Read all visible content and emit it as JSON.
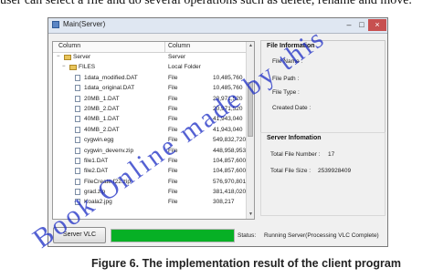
{
  "document": {
    "top_text": "user can select a file and do several operations such as delete, rename and move.",
    "caption": "Figure 6. The implementation result of the client program",
    "watermark": "Book Online made by this"
  },
  "window": {
    "title": "Main(Server)",
    "buttons": {
      "minimize": "–",
      "maximize": "□",
      "close": "×"
    }
  },
  "tree": {
    "columns": [
      "Column",
      "Column"
    ],
    "rows": [
      {
        "indent": 1,
        "kind": "root-folder",
        "expander": "−",
        "name": "Server",
        "type": "Server",
        "size": ""
      },
      {
        "indent": 2,
        "kind": "folder",
        "expander": "−",
        "name": "FILES",
        "type": "Local Folder",
        "size": ""
      },
      {
        "indent": 3,
        "kind": "file",
        "name": "1data_modified.DAT",
        "type": "File",
        "size": "10,485,760"
      },
      {
        "indent": 3,
        "kind": "file",
        "name": "1data_original.DAT",
        "type": "File",
        "size": "10,485,760"
      },
      {
        "indent": 3,
        "kind": "file",
        "name": "20MB_1.DAT",
        "type": "File",
        "size": "20,971,520"
      },
      {
        "indent": 3,
        "kind": "file",
        "name": "20MB_2.DAT",
        "type": "File",
        "size": "20,971,520"
      },
      {
        "indent": 3,
        "kind": "file",
        "name": "40MB_1.DAT",
        "type": "File",
        "size": "41,943,040"
      },
      {
        "indent": 3,
        "kind": "file",
        "name": "40MB_2.DAT",
        "type": "File",
        "size": "41,943,040"
      },
      {
        "indent": 3,
        "kind": "file",
        "name": "cygwin.egg",
        "type": "File",
        "size": "549,832,720"
      },
      {
        "indent": 3,
        "kind": "file",
        "name": "cygwin_devenv.zip",
        "type": "File",
        "size": "448,958,953"
      },
      {
        "indent": 3,
        "kind": "file",
        "name": "file1.DAT",
        "type": "File",
        "size": "104,857,600"
      },
      {
        "indent": 3,
        "kind": "file",
        "name": "file2.DAT",
        "type": "File",
        "size": "104,857,600"
      },
      {
        "indent": 3,
        "kind": "file",
        "name": "FileCreate f22.zip",
        "type": "File",
        "size": "576,970,801"
      },
      {
        "indent": 3,
        "kind": "file",
        "name": "grad.zip",
        "type": "File",
        "size": "381,418,020"
      },
      {
        "indent": 3,
        "kind": "file",
        "name": "Koala2.jpg",
        "type": "File",
        "size": "308,217"
      }
    ]
  },
  "file_info": {
    "legend": "File Information",
    "labels": [
      "File Name :",
      "File Path :",
      "File Type :",
      "Created Date :"
    ]
  },
  "server_info": {
    "legend": "Server Infomation",
    "total_number_label": "Total File Number :",
    "total_number_value": "17",
    "total_size_label": "Total File Size :",
    "total_size_value": "2539928409"
  },
  "bottom": {
    "button_label": "Server VLC",
    "progress_fraction": 1.0,
    "progress_color": "#06b025",
    "status_label": "Status:",
    "status_text": "Running Server(Processing VLC Complete)"
  }
}
